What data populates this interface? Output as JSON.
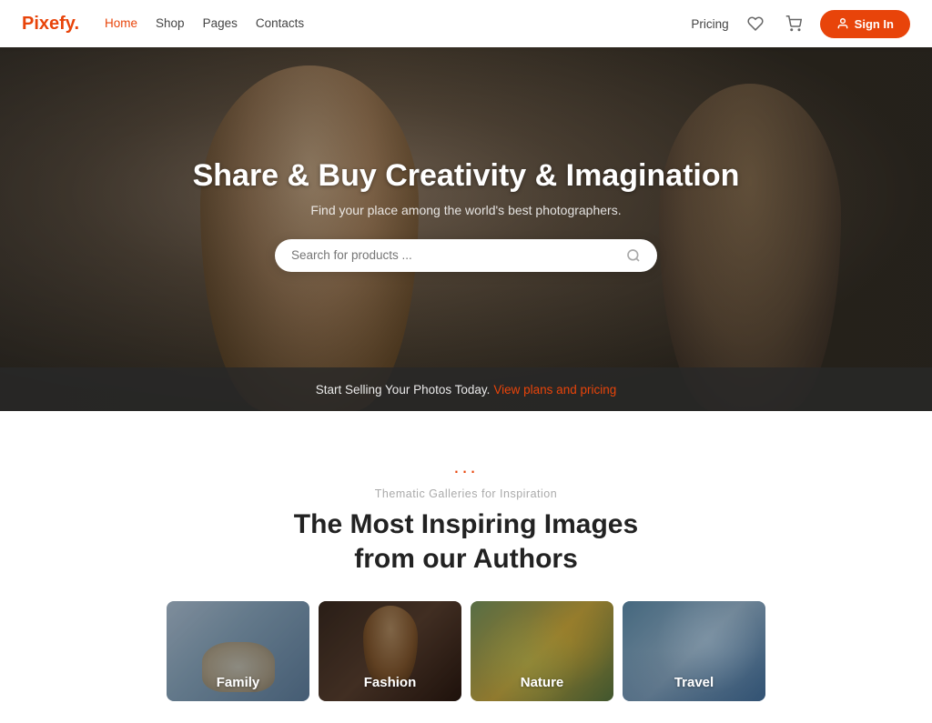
{
  "navbar": {
    "logo_text": "Pixefy",
    "logo_dot": ".",
    "nav_links": [
      {
        "label": "Home",
        "active": true
      },
      {
        "label": "Shop",
        "active": false
      },
      {
        "label": "Pages",
        "active": false
      },
      {
        "label": "Contacts",
        "active": false
      }
    ],
    "pricing_label": "Pricing",
    "signin_label": "Sign In"
  },
  "hero": {
    "title": "Share & Buy Creativity & Imagination",
    "subtitle": "Find your place among the world's best photographers.",
    "search_placeholder": "Search for products ...",
    "bottom_text": "Start Selling Your Photos Today.",
    "bottom_link": "View plans and pricing"
  },
  "galleries_section": {
    "dots": "...",
    "label": "Thematic Galleries for Inspiration",
    "title_line1": "The Most Inspiring Images",
    "title_line2": "from our Authors",
    "cards": [
      {
        "label": "Family",
        "theme": "family"
      },
      {
        "label": "Fashion",
        "theme": "fashion"
      },
      {
        "label": "Nature",
        "theme": "nature"
      },
      {
        "label": "Travel",
        "theme": "travel"
      }
    ]
  }
}
